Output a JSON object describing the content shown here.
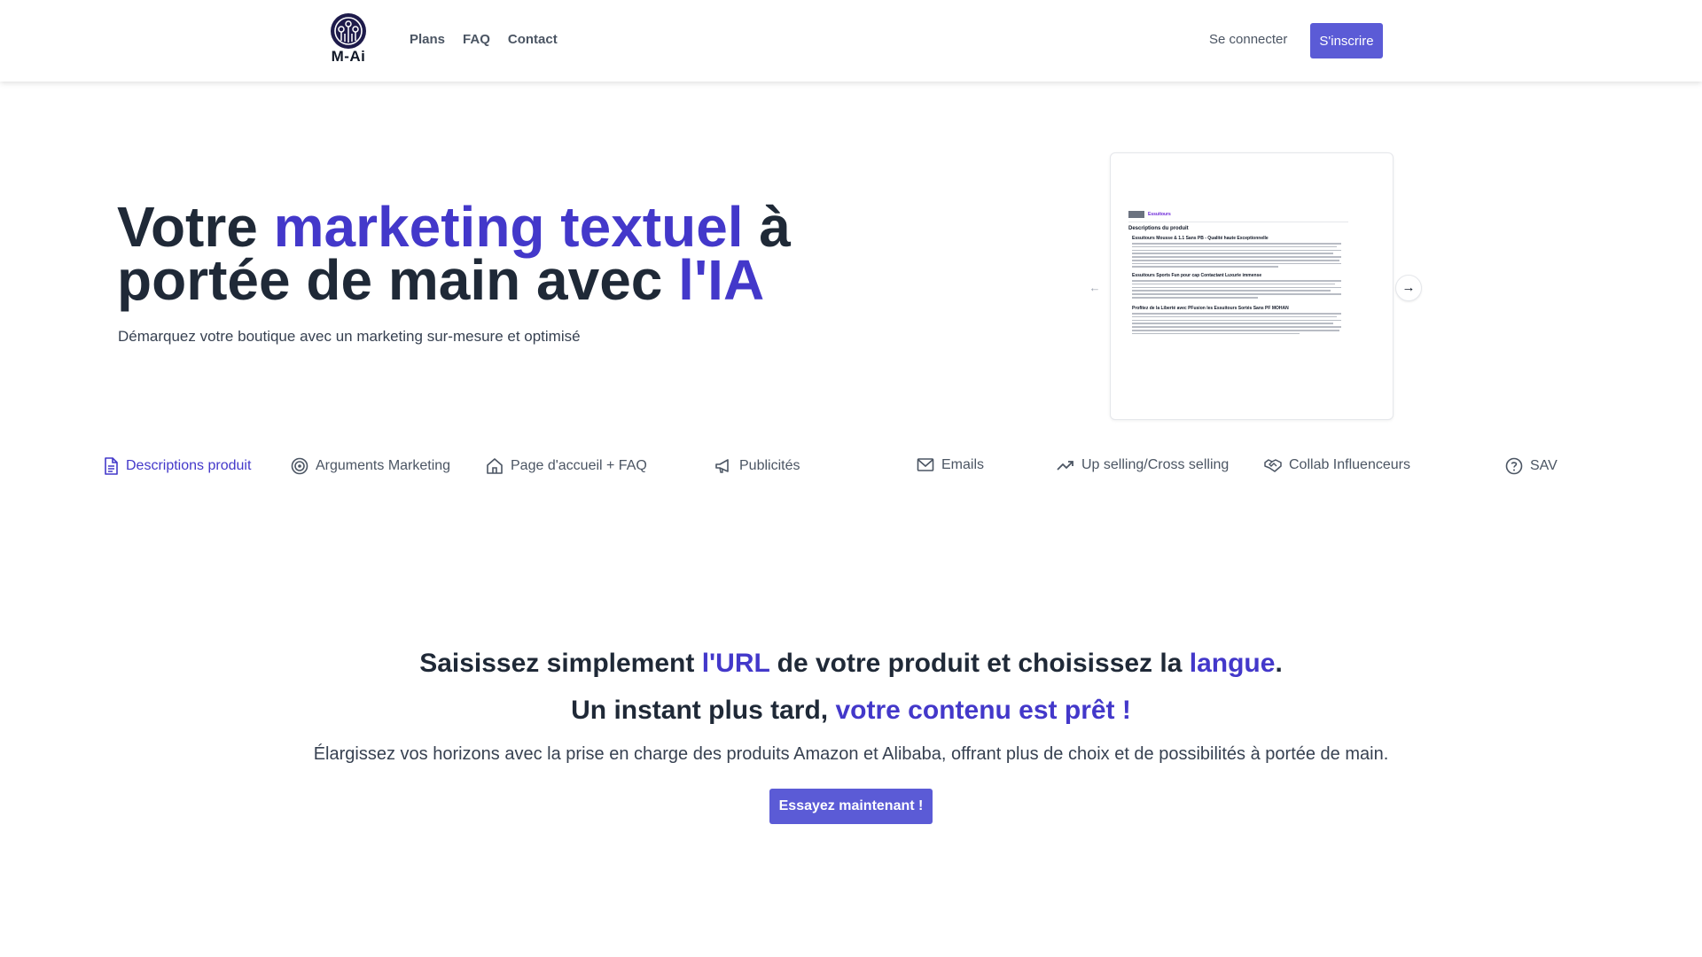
{
  "brand": {
    "name": "M-Ai"
  },
  "nav": {
    "items": [
      "Plans",
      "FAQ",
      "Contact"
    ],
    "login": "Se connecter",
    "signup": "S'inscrire"
  },
  "hero": {
    "title_part1": "Votre ",
    "title_accent1": "marketing textuel",
    "title_part2": " à portée de main avec ",
    "title_accent2": "l'IA",
    "subtitle": "Démarquez votre boutique avec un marketing sur-mesure et optimisé"
  },
  "preview": {
    "brand": "Essuitours",
    "heading": "Descriptions du produit",
    "blocks": [
      {
        "title": "Essuitours Mousse & 1.1 Sans PB - Qualité haute Exceptionnelle"
      },
      {
        "title": "Essuitours Sports Fun pour cap Contactant Luxurie immense"
      },
      {
        "title": "Profitez de la Liberté avec PFusion les Essuitours Sortés Sans PF MOHAN"
      }
    ]
  },
  "tabs": [
    {
      "label": "Descriptions produit",
      "icon": "document-icon",
      "active": true
    },
    {
      "label": "Arguments Marketing",
      "icon": "target-icon",
      "active": false
    },
    {
      "label": "Page d'accueil + FAQ",
      "icon": "home-icon",
      "active": false
    },
    {
      "label": "Publicités",
      "icon": "megaphone-icon",
      "active": false
    },
    {
      "label": "Emails",
      "icon": "mail-icon",
      "active": false
    },
    {
      "label": "Up selling/Cross selling",
      "icon": "trending-up-icon",
      "active": false
    },
    {
      "label": "Collab Influenceurs",
      "icon": "handshake-icon",
      "active": false
    },
    {
      "label": "SAV",
      "icon": "help-circle-icon",
      "active": false
    }
  ],
  "section2": {
    "l1_a": "Saisissez simplement ",
    "l1_b": "l'URL",
    "l1_c": " de votre produit et choisissez la ",
    "l1_d": "langue",
    "l1_e": ".",
    "l2_a": "Un instant plus tard, ",
    "l2_b": "votre contenu est prêt !",
    "subtitle": "Élargissez vos horizons avec la prise en charge des produits Amazon et Alibaba, offrant plus de choix et de possibilités à portée de main.",
    "cta": "Essayez maintenant !"
  },
  "colors": {
    "accent": "#4338ca",
    "button": "#5b5bd6",
    "text": "#1f2937",
    "muted": "#4b5563"
  }
}
